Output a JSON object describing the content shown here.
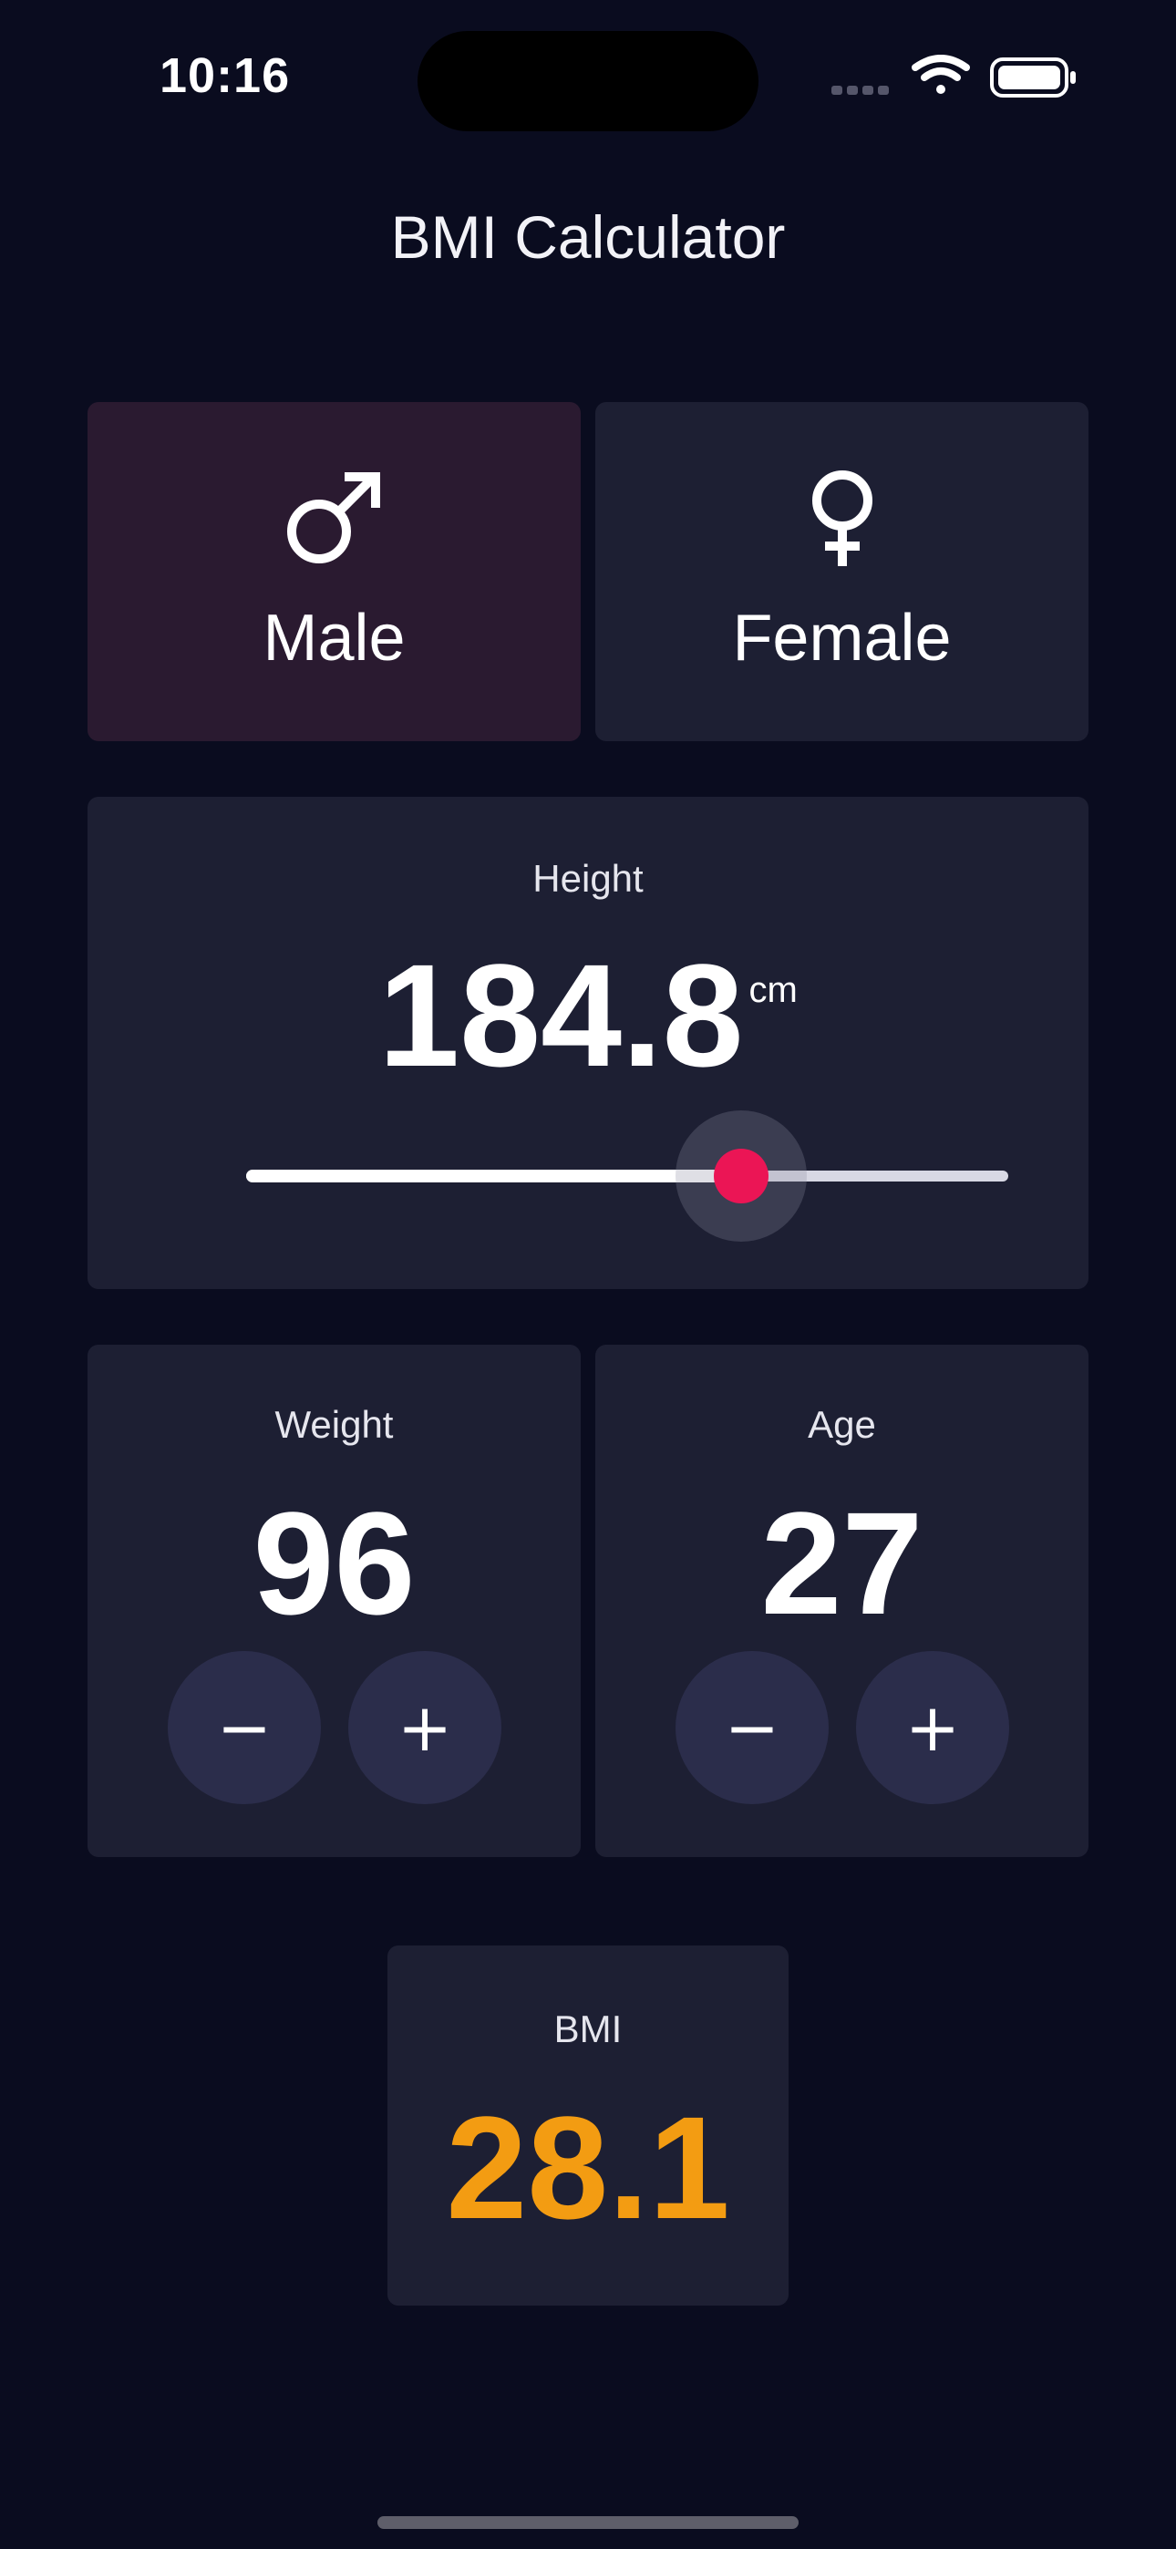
{
  "status_bar": {
    "time": "10:16",
    "icons": [
      "cellular-signal-icon",
      "wifi-icon",
      "battery-icon"
    ]
  },
  "app": {
    "title": "BMI Calculator"
  },
  "gender": {
    "selected": "male",
    "male": {
      "label": "Male",
      "icon": "male-symbol-icon"
    },
    "female": {
      "label": "Female",
      "icon": "female-symbol-icon"
    }
  },
  "height": {
    "label": "Height",
    "value": "184.8",
    "unit": "cm",
    "slider_fraction": 0.65
  },
  "weight": {
    "label": "Weight",
    "value": "96",
    "decrement": "−",
    "increment": "+"
  },
  "age": {
    "label": "Age",
    "value": "27",
    "decrement": "−",
    "increment": "+"
  },
  "bmi": {
    "label": "BMI",
    "value": "28.1"
  },
  "colors": {
    "background": "#0A0C1F",
    "card": "#1D1F33",
    "card_selected": "#2A1A30",
    "accent": "#EB1555",
    "bmi_value": "#F39C12",
    "button": "#2B2D4B"
  }
}
